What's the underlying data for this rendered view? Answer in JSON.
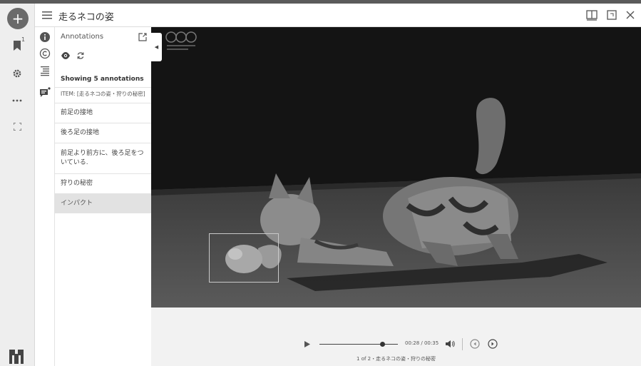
{
  "window": {
    "title": "走るネコの姿"
  },
  "rail": {
    "bookmark_badge": "1"
  },
  "panel": {
    "heading": "Annotations",
    "count_text": "Showing 5 annotations",
    "item_tag": "ITEM: [走るネコの姿・狩りの秘密]",
    "annotations": [
      "前足の接地",
      "後ろ足の接地",
      "前足より前方に、後ろ足をついている.",
      "狩りの秘密",
      "インパクト"
    ]
  },
  "player": {
    "time": "00:28 / 00:35",
    "progress": 0.8,
    "caption": "1 of 2・走るネコの姿・狩りの秘密"
  },
  "colors": {
    "rail_bg": "#eeeeee",
    "active_row": "#e2e2e2",
    "add_button": "#6a6a6a"
  }
}
